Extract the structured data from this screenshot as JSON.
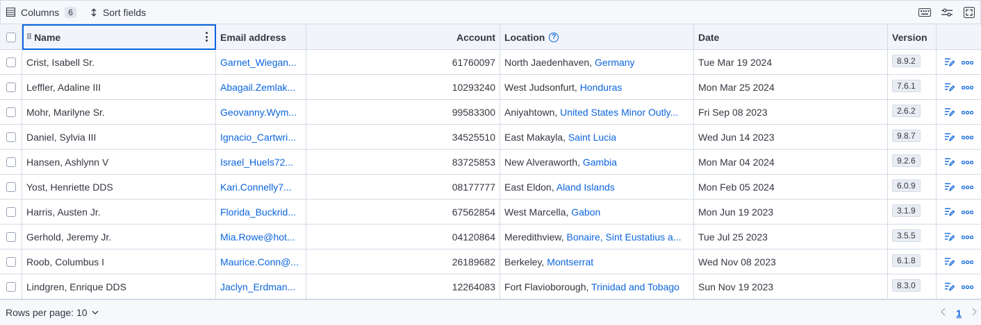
{
  "toolbar": {
    "columns_label": "Columns",
    "columns_count": "6",
    "sort_label": "Sort fields"
  },
  "columns": {
    "name": "Name",
    "email": "Email address",
    "account": "Account",
    "location": "Location",
    "date": "Date",
    "version": "Version"
  },
  "rows": [
    {
      "name": "Crist, Isabell Sr.",
      "email": "Garnet_Wiegan...",
      "account": "61760097",
      "city": "North Jaedenhaven,",
      "country": "Germany",
      "date": "Tue Mar 19 2024",
      "version": "8.9.2"
    },
    {
      "name": "Leffler, Adaline III",
      "email": "Abagail.Zemlak...",
      "account": "10293240",
      "city": "West Judsonfurt,",
      "country": "Honduras",
      "date": "Mon Mar 25 2024",
      "version": "7.6.1"
    },
    {
      "name": "Mohr, Marilyne Sr.",
      "email": "Geovanny.Wym...",
      "account": "99583300",
      "city": "Aniyahtown,",
      "country": "United States Minor Outly...",
      "date": "Fri Sep 08 2023",
      "version": "2.6.2"
    },
    {
      "name": "Daniel, Sylvia III",
      "email": "Ignacio_Cartwri...",
      "account": "34525510",
      "city": "East Makayla,",
      "country": "Saint Lucia",
      "date": "Wed Jun 14 2023",
      "version": "9.8.7"
    },
    {
      "name": "Hansen, Ashlynn V",
      "email": "Israel_Huels72...",
      "account": "83725853",
      "city": "New Alveraworth,",
      "country": "Gambia",
      "date": "Mon Mar 04 2024",
      "version": "9.2.6"
    },
    {
      "name": "Yost, Henriette DDS",
      "email": "Kari.Connelly7...",
      "account": "08177777",
      "city": "East Eldon,",
      "country": "Aland Islands",
      "date": "Mon Feb 05 2024",
      "version": "6.0.9"
    },
    {
      "name": "Harris, Austen Jr.",
      "email": "Florida_Buckrid...",
      "account": "67562854",
      "city": "West Marcella,",
      "country": "Gabon",
      "date": "Mon Jun 19 2023",
      "version": "3.1.9"
    },
    {
      "name": "Gerhold, Jeremy Jr.",
      "email": "Mia.Rowe@hot...",
      "account": "04120864",
      "city": "Meredithview,",
      "country": "Bonaire, Sint Eustatius a...",
      "date": "Tue Jul 25 2023",
      "version": "3.5.5"
    },
    {
      "name": "Roob, Columbus I",
      "email": "Maurice.Conn@...",
      "account": "26189682",
      "city": "Berkeley,",
      "country": "Montserrat",
      "date": "Wed Nov 08 2023",
      "version": "6.1.8"
    },
    {
      "name": "Lindgren, Enrique DDS",
      "email": "Jaclyn_Erdman...",
      "account": "12264083",
      "city": "Fort Flavioborough,",
      "country": "Trinidad and Tobago",
      "date": "Sun Nov 19 2023",
      "version": "8.3.0"
    }
  ],
  "footer": {
    "rows_per_page": "Rows per page: 10",
    "current_page": "1"
  },
  "colors": {
    "accent": "#0b64dd",
    "header_bg": "#f1f4fa",
    "border": "#d3dae6"
  },
  "icons": [
    "table-icon",
    "sort-icon",
    "keyboard-icon",
    "display-settings-icon",
    "fullscreen-icon",
    "help-icon",
    "edit-icon",
    "more-icon",
    "chevron-down-icon",
    "chevron-left-icon",
    "chevron-right-icon",
    "drag-handle-icon",
    "column-menu-icon"
  ]
}
